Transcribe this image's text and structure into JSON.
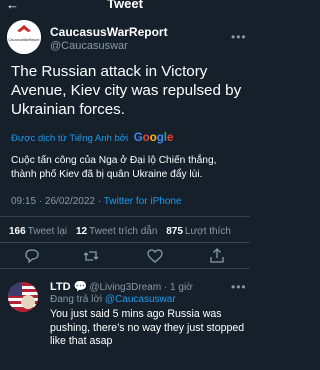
{
  "header": {
    "title": "Tweet",
    "back_icon": "arrow-left-icon"
  },
  "author": {
    "name": "CaucasusWarReport",
    "handle": "@Caucasuswar",
    "avatar_text": "CaucasusWarReport",
    "more_icon": "more-icon"
  },
  "tweet": {
    "text": "The Russian attack in Victory Avenue, Kiev city was repulsed by Ukrainian forces.",
    "translated_by": "Được dịch từ Tiếng Anh bởi",
    "translator": "Google",
    "translation": "Cuộc tấn công của Nga ở Đại lộ Chiến thắng, thành phố Kiev đã bị quân Ukraine đẩy lùi.",
    "time": "09:15 · 26/02/2022 ·",
    "source": "Twitter for iPhone"
  },
  "stats": {
    "retweets_count": "166",
    "retweets_label": "Tweet lại",
    "quotes_count": "12",
    "quotes_label": "Tweet trích dẫn",
    "likes_count": "875",
    "likes_label": "Lượt thích"
  },
  "reply": {
    "name": "LTD 💬",
    "handle": "@Living3Dream · 1 giờ",
    "replying_prefix": "Đang trả lời",
    "replying_to": "@Caucasuswar",
    "text": "You just said 5 mins ago Russia was pushing, there’s no way they just stopped like that asap"
  },
  "colors": {
    "background": "#15202b",
    "secondary_text": "#8899a6",
    "link": "#1d9bf0",
    "divider": "#38444d"
  }
}
